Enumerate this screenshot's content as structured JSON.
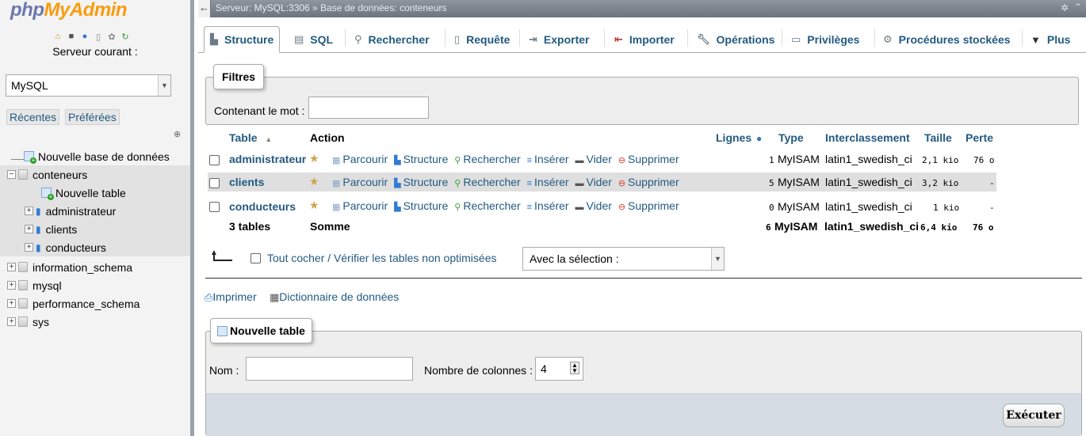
{
  "navigation": {
    "logo_php": "php",
    "logo_myadmin": "MyAdmin",
    "server_label": "Serveur courant :",
    "server_value": "MySQL",
    "recent": "Récentes",
    "favorites": "Préférées",
    "tree": {
      "new_db": "Nouvelle base de données",
      "current_db": "conteneurs",
      "new_table": "Nouvelle table",
      "tables": [
        "administrateur",
        "clients",
        "conducteurs"
      ],
      "other_dbs": [
        "information_schema",
        "mysql",
        "performance_schema",
        "sys"
      ]
    }
  },
  "topbar": {
    "breadcrumb": "Serveur: MySQL:3306 » Base de données: conteneurs"
  },
  "tabs": [
    "Structure",
    "SQL",
    "Rechercher",
    "Requête",
    "Exporter",
    "Importer",
    "Opérations",
    "Privilèges",
    "Procédures stockées",
    "Plus"
  ],
  "filters": {
    "legend": "Filtres",
    "label": "Contenant le mot :",
    "value": ""
  },
  "table": {
    "headers": {
      "table": "Table",
      "action": "Action",
      "rows": "Lignes",
      "type": "Type",
      "collation": "Interclassement",
      "size": "Taille",
      "overhead": "Perte"
    },
    "actions": [
      "Parcourir",
      "Structure",
      "Rechercher",
      "Insérer",
      "Vider",
      "Supprimer"
    ],
    "rows": [
      {
        "name": "administrateur",
        "rows": "1",
        "type": "MyISAM",
        "collation": "latin1_swedish_ci",
        "size": "2,1 kio",
        "overhead": "76 o"
      },
      {
        "name": "clients",
        "rows": "5",
        "type": "MyISAM",
        "collation": "latin1_swedish_ci",
        "size": "3,2 kio",
        "overhead": "-"
      },
      {
        "name": "conducteurs",
        "rows": "0",
        "type": "MyISAM",
        "collation": "latin1_swedish_ci",
        "size": "1 kio",
        "overhead": "-"
      }
    ],
    "footer": {
      "count": "3 tables",
      "label": "Somme",
      "rows": "6",
      "type": "MyISAM",
      "collation": "latin1_swedish_ci",
      "size": "6,4 kio",
      "overhead": "76 o"
    }
  },
  "bulk": {
    "check_all": "Tout cocher / Vérifier les tables non optimisées",
    "with_selection": "Avec la sélection :"
  },
  "links": {
    "print": "Imprimer",
    "data_dictionary": "Dictionnaire de données"
  },
  "new_table": {
    "legend": "Nouvelle table",
    "name_label": "Nom :",
    "name_value": "",
    "columns_label": "Nombre de colonnes :",
    "columns_value": "4",
    "submit": "Exécuter"
  }
}
